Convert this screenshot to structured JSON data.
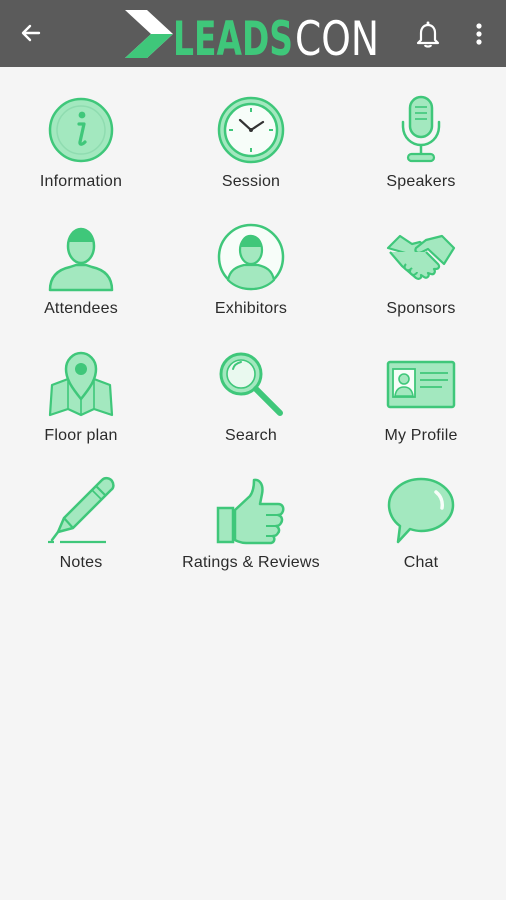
{
  "app_bar": {
    "brand_left": "LEADS",
    "brand_right": "CON",
    "back_icon": "arrow-back-icon",
    "bell_icon": "bell-icon",
    "more_icon": "more-vert-icon"
  },
  "colors": {
    "app_bar": "#5b5b5b",
    "accent_green": "#3fc77a",
    "icon_fill": "#a3e8bf",
    "background": "#f5f5f5"
  },
  "menu": {
    "items": [
      {
        "label": "Information",
        "icon": "info-icon"
      },
      {
        "label": "Session",
        "icon": "clock-icon"
      },
      {
        "label": "Speakers",
        "icon": "microphone-icon"
      },
      {
        "label": "Attendees",
        "icon": "person-icon"
      },
      {
        "label": "Exhibitors",
        "icon": "person-circle-icon"
      },
      {
        "label": "Sponsors",
        "icon": "handshake-icon"
      },
      {
        "label": "Floor plan",
        "icon": "map-pin-icon"
      },
      {
        "label": "Search",
        "icon": "magnifier-icon"
      },
      {
        "label": "My Profile",
        "icon": "id-card-icon"
      },
      {
        "label": "Notes",
        "icon": "pen-icon"
      },
      {
        "label": "Ratings & Reviews",
        "icon": "thumbs-up-icon"
      },
      {
        "label": "Chat",
        "icon": "speech-bubble-icon"
      }
    ]
  }
}
